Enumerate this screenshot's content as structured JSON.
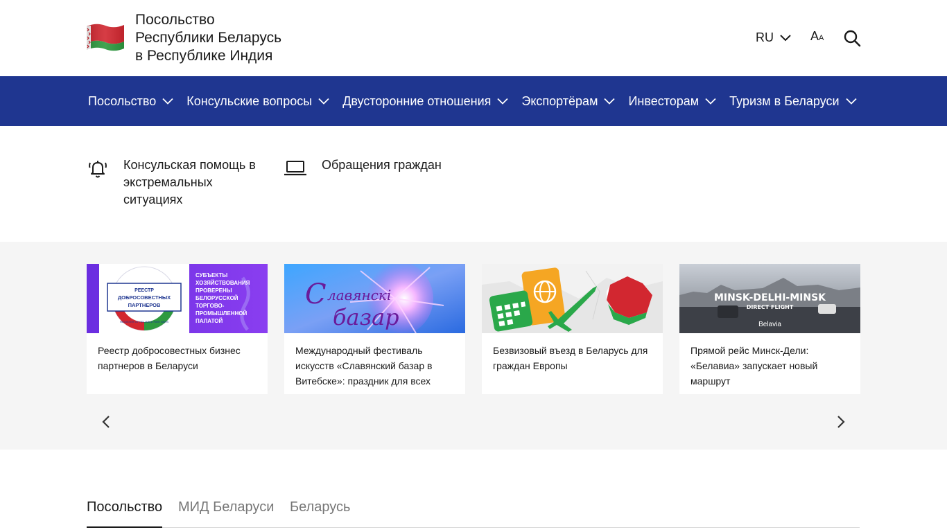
{
  "header": {
    "title_lines": [
      "Посольство",
      "Республики Беларусь",
      "в Республике Индия"
    ],
    "language": "RU",
    "font_size_big": "A",
    "font_size_small": "A"
  },
  "nav": {
    "items": [
      {
        "label": "Посольство"
      },
      {
        "label": "Консульские вопросы"
      },
      {
        "label": "Двусторонние отношения"
      },
      {
        "label": "Экспортёрам"
      },
      {
        "label": "Инвесторам"
      },
      {
        "label": "Туризм в Беларуси"
      }
    ]
  },
  "quick_links": [
    {
      "icon": "bell-icon",
      "lines": [
        "Консульская помощь в",
        "экстремальных",
        "ситуациях"
      ]
    },
    {
      "icon": "laptop-icon",
      "lines": [
        "Обращения граждан"
      ]
    }
  ],
  "carousel": {
    "cards": [
      {
        "text": "Реестр добросовестных бизнес партнеров в Беларуси",
        "image_text": {
          "seal_lines": [
            "РЕЕСТР",
            "ДОБРОСОВЕСТНЫХ",
            "ПАРТНЕРОВ"
          ],
          "seal_ring": "REGISTER OF RELIABLE PARTNERS",
          "side_lines": [
            "СУБЪЕКТЫ",
            "ХОЗЯЙСТВОВАНИЯ",
            "ПРОВЕРЕНЫ",
            "БЕЛОРУССКОЙ",
            "ТОРГОВО-",
            "ПРОМЫШЛЕННОЙ",
            "ПАЛАТОЙ"
          ]
        }
      },
      {
        "text": "Международный фестиваль искусств «Славянский базар в Витебске»: праздник для всех",
        "image_text": {
          "logo_line1": "лавянскі",
          "logo_line2": "базар",
          "logo_initial": "С"
        }
      },
      {
        "text": "Безвизовый въезд в Беларусь для граждан Европы"
      },
      {
        "text": "Прямой рейс Минск-Дели: «Белавиа» запускает новый маршрут",
        "image_text": {
          "headline": "MINSK-DELHI-MINSK",
          "sub": "DIRECT FLIGHT",
          "brand": "Belavia"
        }
      }
    ]
  },
  "tabs": [
    {
      "label": "Посольство",
      "active": true
    },
    {
      "label": "МИД Беларуси",
      "active": false
    },
    {
      "label": "Беларусь",
      "active": false
    }
  ],
  "colors": {
    "nav_bg": "#1f3690",
    "carousel_bg": "#f5f5f5",
    "flag_red": "#d22730",
    "flag_green": "#00a651"
  }
}
